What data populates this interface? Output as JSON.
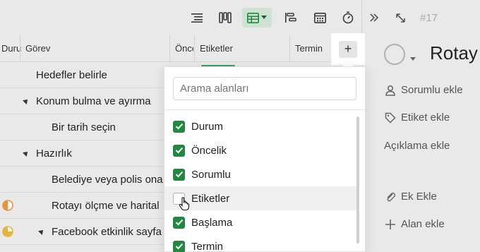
{
  "toolbar": {
    "icons": [
      "list-view-icon",
      "board-view-icon",
      "table-view-icon",
      "gantt-view-icon",
      "calendar-view-icon",
      "timer-icon"
    ]
  },
  "table": {
    "columns": [
      "Duru",
      "Görev",
      "Önce",
      "Etiketler",
      "Termin"
    ],
    "add_column_label": "+",
    "rows": [
      {
        "task": "Hedefler belirle",
        "indent": 0,
        "expandable": false
      },
      {
        "task": "Konum bulma ve ayırma",
        "indent": 0,
        "expandable": true
      },
      {
        "task": "Bir tarih seçin",
        "indent": 1,
        "expandable": false
      },
      {
        "task": "Hazırlık",
        "indent": 0,
        "expandable": true
      },
      {
        "task": "Belediye veya polis ona",
        "indent": 1,
        "expandable": false
      },
      {
        "task": "Rotayı ölçme ve harital",
        "indent": 1,
        "expandable": false
      },
      {
        "task": "Facebook etkinlik sayfa",
        "indent": 1,
        "expandable": true
      }
    ]
  },
  "dropdown": {
    "search_placeholder": "Arama alanları",
    "options": [
      {
        "label": "Durum",
        "checked": true
      },
      {
        "label": "Öncelik",
        "checked": true
      },
      {
        "label": "Sorumlu",
        "checked": true
      },
      {
        "label": "Etiketler",
        "checked": false
      },
      {
        "label": "Başlama",
        "checked": true
      },
      {
        "label": "Termin",
        "checked": true
      }
    ]
  },
  "side_panel": {
    "task_id": "#17",
    "title": "Rotay",
    "assign_label": "Sorumlu ekle",
    "tag_label": "Etiket ekle",
    "description_label": "Açıklama ekle",
    "attach_label": "Ek Ekle",
    "add_field_label": "Alan ekle"
  },
  "colors": {
    "accent_green": "#1d8a3d",
    "status_orange": "#e8923a",
    "status_yellow": "#e6b43c"
  }
}
